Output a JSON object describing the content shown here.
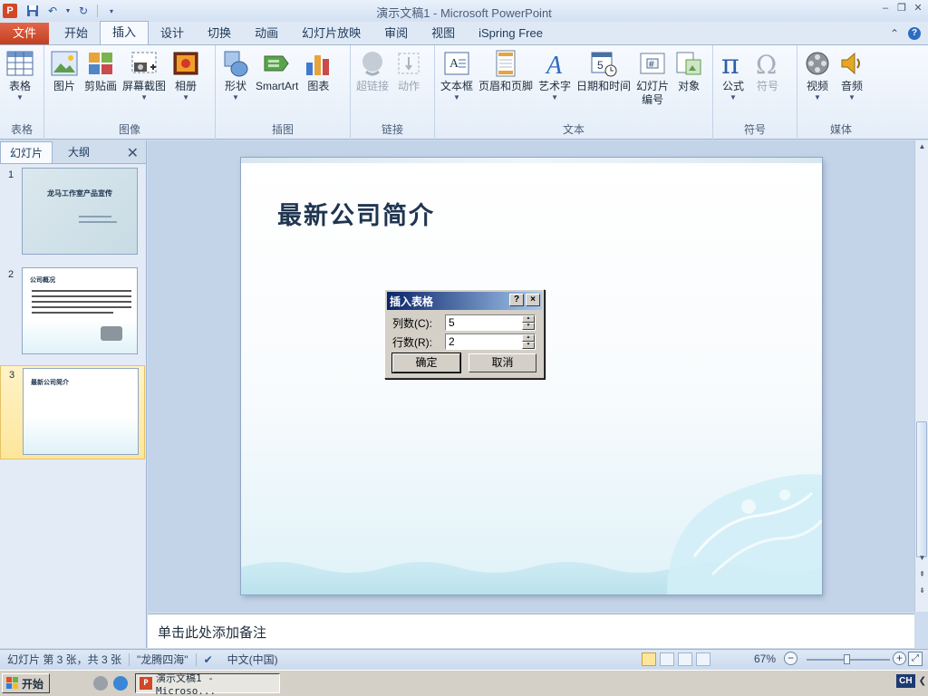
{
  "window": {
    "title": "演示文稿1 - Microsoft PowerPoint",
    "app_icon_letter": "P"
  },
  "ribbon_tabs": [
    {
      "label": "文件",
      "type": "file"
    },
    {
      "label": "开始"
    },
    {
      "label": "插入",
      "active": true
    },
    {
      "label": "设计"
    },
    {
      "label": "切换"
    },
    {
      "label": "动画"
    },
    {
      "label": "幻灯片放映"
    },
    {
      "label": "审阅"
    },
    {
      "label": "视图"
    },
    {
      "label": "iSpring Free"
    }
  ],
  "ribbon": {
    "groups": {
      "table": {
        "label": "表格",
        "buttons": {
          "table": "表格"
        }
      },
      "images": {
        "label": "图像",
        "buttons": {
          "picture": "图片",
          "clipart": "剪贴画",
          "screenshot": "屏幕截图",
          "album": "相册"
        }
      },
      "illustrations": {
        "label": "插图",
        "buttons": {
          "shapes": "形状",
          "smartart": "SmartArt",
          "chart": "图表"
        }
      },
      "links": {
        "label": "链接",
        "buttons": {
          "hyperlink": "超链接",
          "action": "动作"
        }
      },
      "text": {
        "label": "文本",
        "buttons": {
          "textbox": "文本框",
          "header_footer": "页眉和页脚",
          "wordart": "艺术字",
          "datetime": "日期和时间",
          "slide_number_1": "幻灯片",
          "slide_number_2": "编号",
          "object": "对象"
        }
      },
      "symbols": {
        "label": "符号",
        "buttons": {
          "equation": "公式",
          "symbol": "符号"
        }
      },
      "media": {
        "label": "媒体",
        "buttons": {
          "video": "视频",
          "audio": "音频"
        }
      }
    }
  },
  "left_pane": {
    "tabs": {
      "slides": "幻灯片",
      "outline": "大纲"
    },
    "thumbnails": [
      {
        "number": "1",
        "title": "龙马工作室产品宣传"
      },
      {
        "number": "2",
        "title": "公司概况"
      },
      {
        "number": "3",
        "title": "最新公司简介",
        "selected": true
      }
    ]
  },
  "slide": {
    "title": "最新公司简介"
  },
  "dialog": {
    "title": "插入表格",
    "help": "?",
    "close": "×",
    "columns_label": "列数(C):",
    "columns_value": "5",
    "rows_label": "行数(R):",
    "rows_value": "2",
    "ok": "确定",
    "cancel": "取消"
  },
  "notes": {
    "placeholder": "单击此处添加备注"
  },
  "status_bar": {
    "slide_info": "幻灯片 第 3 张，共 3 张",
    "theme": "\"龙腾四海\"",
    "language": "中文(中国)",
    "zoom": "67%",
    "zoom_fraction": 0.45
  },
  "taskbar": {
    "start": "开始",
    "task": "演示文稿1 - Microso...",
    "ime": "CH"
  },
  "colors": {
    "file_tab": "#d24726",
    "accent": "#2b579a",
    "selection": "#fde69b"
  }
}
